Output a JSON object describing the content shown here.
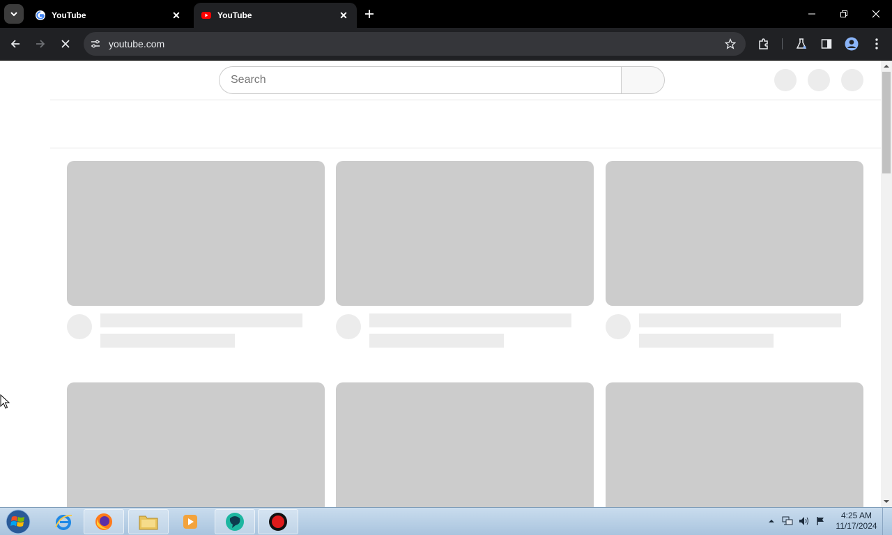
{
  "browser": {
    "tabs": [
      {
        "title": "YouTube",
        "active": false,
        "favicon": "google-icon"
      },
      {
        "title": "YouTube",
        "active": true,
        "favicon": "youtube-icon"
      }
    ],
    "address": "youtube.com"
  },
  "page": {
    "search_placeholder": "Search",
    "cards": 6
  },
  "taskbar": {
    "time": "4:25 AM",
    "date": "11/17/2024",
    "apps": [
      "internet-explorer-icon",
      "firefox-icon",
      "file-explorer-icon",
      "media-player-icon",
      "chat-app-icon",
      "record-icon"
    ]
  },
  "colors": {
    "skeleton_dark": "#cccccc",
    "skeleton_light": "#ececec",
    "browser_chrome": "#202124"
  }
}
